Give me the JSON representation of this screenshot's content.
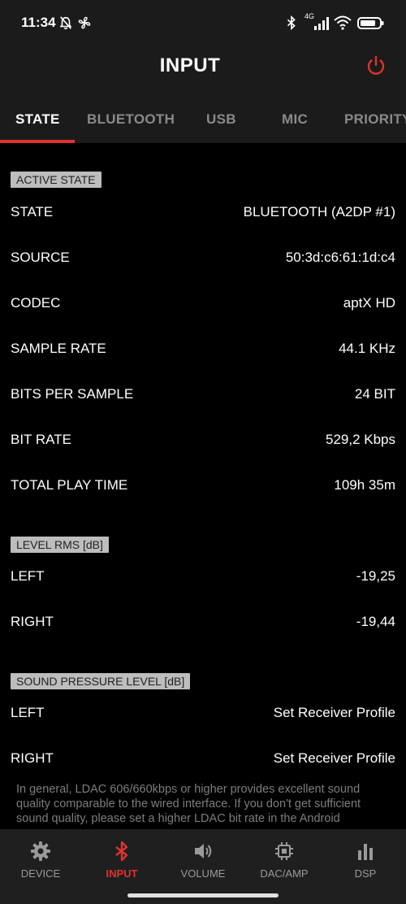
{
  "status_bar": {
    "time": "11:34",
    "network": "4G",
    "icons": [
      "muted-bell-icon",
      "fan-icon",
      "bluetooth-icon",
      "signal-icon",
      "wifi-icon",
      "battery-icon"
    ]
  },
  "header": {
    "title": "INPUT",
    "power_icon": "power-icon",
    "accent": "#e0322c"
  },
  "tabs": [
    {
      "label": "STATE",
      "active": true
    },
    {
      "label": "BLUETOOTH",
      "active": false
    },
    {
      "label": "USB",
      "active": false
    },
    {
      "label": "MIC",
      "active": false
    },
    {
      "label": "PRIORITY",
      "active": false
    }
  ],
  "sections": {
    "active_state": {
      "title": "ACTIVE STATE",
      "rows": [
        {
          "label": "STATE",
          "value": "BLUETOOTH (A2DP #1)"
        },
        {
          "label": "SOURCE",
          "value": "50:3d:c6:61:1d:c4"
        },
        {
          "label": "CODEC",
          "value": "aptX HD"
        },
        {
          "label": "SAMPLE RATE",
          "value": "44.1 KHz"
        },
        {
          "label": "BITS PER SAMPLE",
          "value": "24 BIT"
        },
        {
          "label": "BIT RATE",
          "value": "529,2 Kbps"
        },
        {
          "label": "TOTAL PLAY TIME",
          "value": "109h 35m"
        }
      ]
    },
    "level_rms": {
      "title": "LEVEL RMS [dB]",
      "rows": [
        {
          "label": "LEFT",
          "value": "-19,25"
        },
        {
          "label": "RIGHT",
          "value": "-19,44"
        }
      ]
    },
    "spl": {
      "title": "SOUND PRESSURE LEVEL [dB]",
      "rows": [
        {
          "label": "LEFT",
          "value": "Set Receiver Profile"
        },
        {
          "label": "RIGHT",
          "value": "Set Receiver Profile"
        }
      ]
    }
  },
  "note": "In general, LDAC 606/660kbps or higher provides excellent sound quality comparable to the wired interface. If you don't get sufficient sound quality, please set a higher LDAC bit rate in the Android",
  "bottom_nav": [
    {
      "label": "DEVICE",
      "icon": "gear-icon",
      "active": false
    },
    {
      "label": "INPUT",
      "icon": "bluetooth-icon",
      "active": true
    },
    {
      "label": "VOLUME",
      "icon": "speaker-icon",
      "active": false
    },
    {
      "label": "DAC/AMP",
      "icon": "chip-icon",
      "active": false
    },
    {
      "label": "DSP",
      "icon": "bars-chart-icon",
      "active": false
    }
  ]
}
